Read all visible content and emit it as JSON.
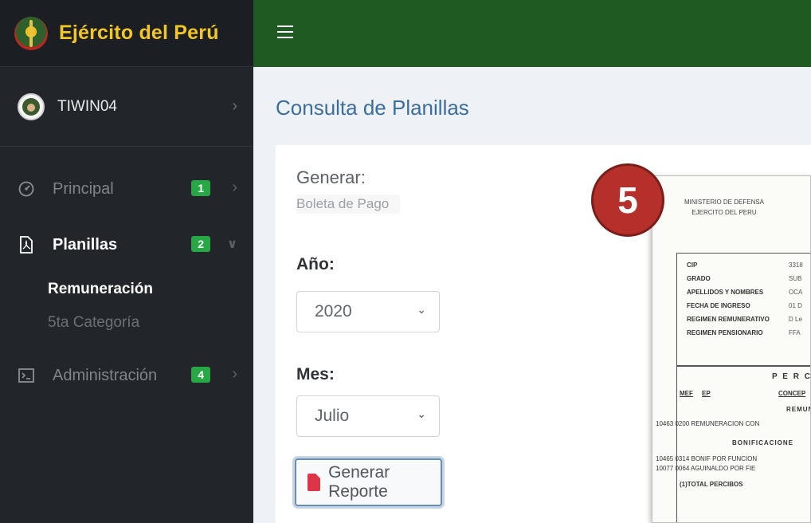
{
  "brand": {
    "title": "Ejército del Perú"
  },
  "user": {
    "name": "TIWIN04"
  },
  "sidebar": {
    "items": [
      {
        "label": "Principal",
        "badge": "1"
      },
      {
        "label": "Planillas",
        "badge": "2"
      },
      {
        "label": "Administración",
        "badge": "4"
      }
    ],
    "sub_items": [
      {
        "label": "Remuneración"
      },
      {
        "label": "5ta Categoría"
      }
    ]
  },
  "page": {
    "title": "Consulta de Planillas"
  },
  "form": {
    "generate_label": "Generar:",
    "generate_value": "Boleta de Pago",
    "year_label": "Año:",
    "year_value": "2020",
    "month_label": "Mes:",
    "month_value": "Julio",
    "button_label": "Generar Reporte"
  },
  "step_marker": "5",
  "document": {
    "header_1": "MINISTERIO DE DEFENSA",
    "header_2": "EJERCITO DEL PERU",
    "rows": [
      {
        "k": "CIP",
        "v": "3318"
      },
      {
        "k": "GRADO",
        "v": "SUB"
      },
      {
        "k": "APELLIDOS Y NOMBRES",
        "v": "OCA"
      },
      {
        "k": "FECHA DE INGRESO",
        "v": "01 D"
      },
      {
        "k": "REGIMEN REMUNERATIVO",
        "v": "D Le"
      },
      {
        "k": "REGIMEN PENSIONARIO",
        "v": "FFA"
      }
    ],
    "section_title": "P E R C",
    "col_mef": "MEF",
    "col_ep": "EP",
    "col_concept": "CONCEP",
    "remun_heading": "REMUN",
    "line_1": "10463  0200  REMUNERACION CON",
    "bonif_heading": "BONIFICACIONE",
    "line_2": "10465  0314  BONIF POR FUNCION",
    "line_3": "10077  0064  AGUINALDO POR FIE",
    "total": "(1)TOTAL PERCIBOS"
  },
  "colors": {
    "topbar": "#1f5a23",
    "brand_text": "#f3c623",
    "badge": "#28a745",
    "page_title": "#3b6e9e",
    "step_marker": "#b5302a"
  }
}
